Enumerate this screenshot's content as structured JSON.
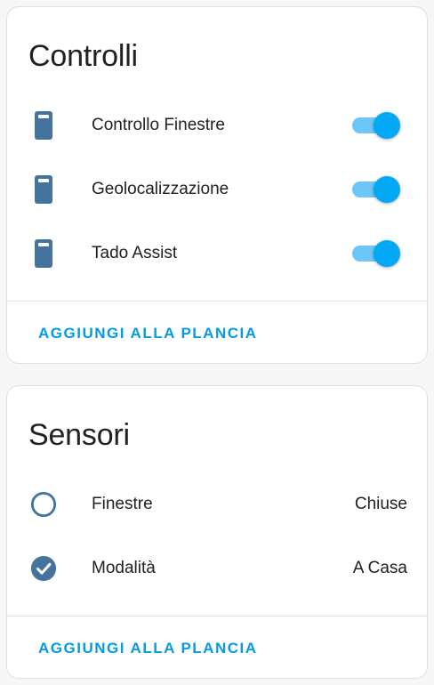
{
  "colors": {
    "accent": "#03a9f4",
    "icon": "#44739e",
    "toggle_track": "#6cc6f7"
  },
  "controls_card": {
    "title": "Controlli",
    "items": [
      {
        "label": "Controllo Finestre",
        "icon": "door-panel-icon",
        "on": true
      },
      {
        "label": "Geolocalizzazione",
        "icon": "door-panel-icon",
        "on": true
      },
      {
        "label": "Tado Assist",
        "icon": "door-panel-icon",
        "on": true
      }
    ],
    "action_label": "AGGIUNGI ALLA PLANCIA"
  },
  "sensors_card": {
    "title": "Sensori",
    "items": [
      {
        "label": "Finestre",
        "icon": "circle-outline-icon",
        "state": "Chiuse"
      },
      {
        "label": "Modalità",
        "icon": "check-circle-icon",
        "state": "A Casa"
      }
    ],
    "action_label": "AGGIUNGI ALLA PLANCIA"
  }
}
